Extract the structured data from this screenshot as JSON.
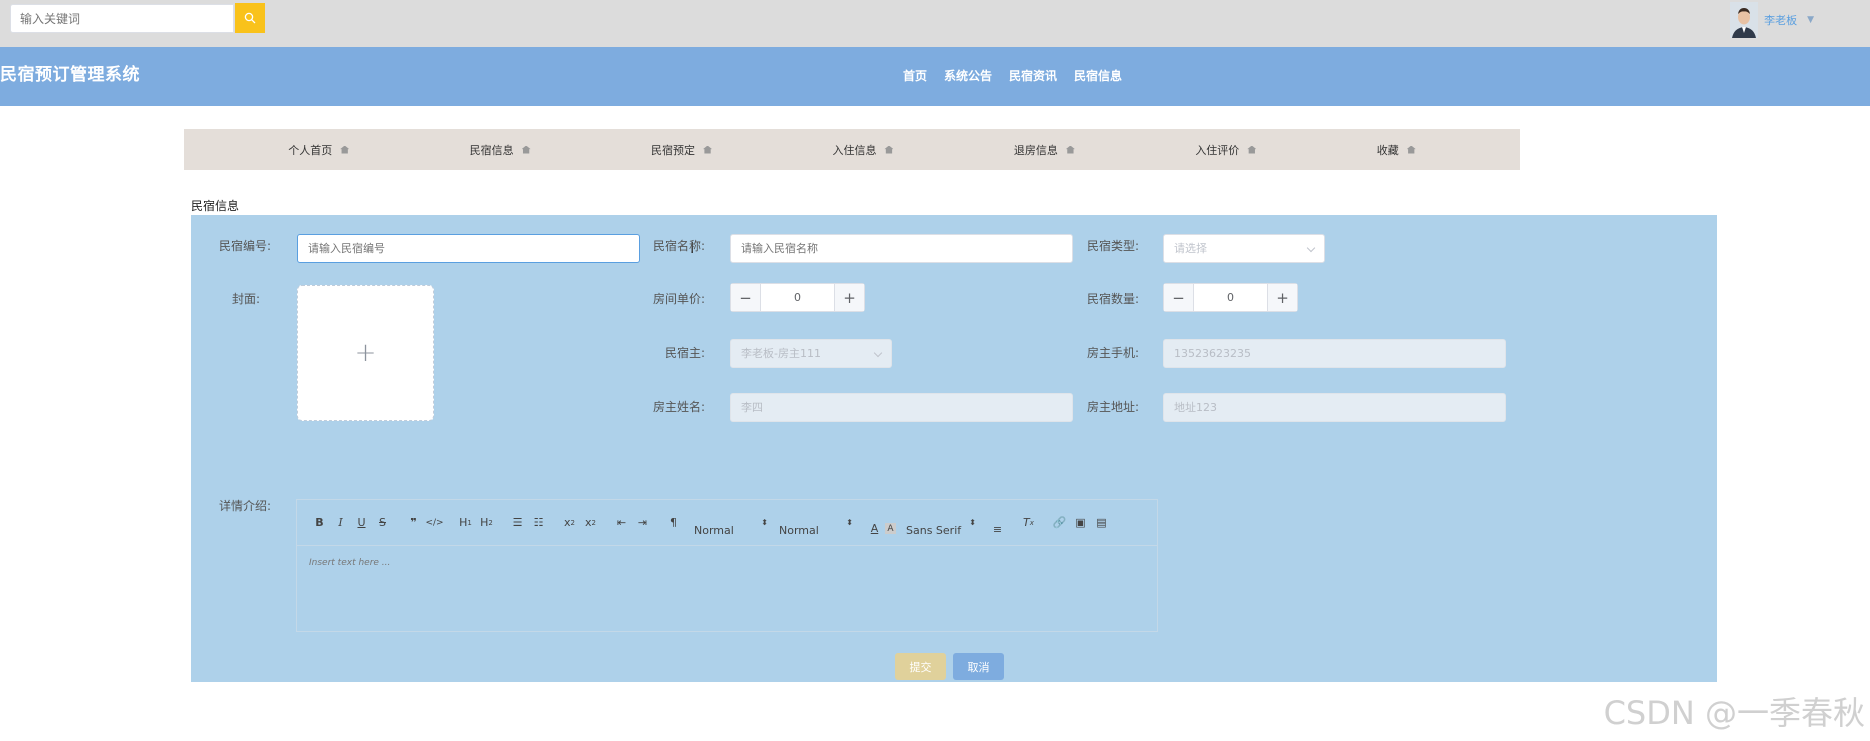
{
  "topbar": {
    "search_placeholder": "输入关键词",
    "user_name": "李老板"
  },
  "header": {
    "site_title": "民宿预订管理系统",
    "nav": [
      "首页",
      "系统公告",
      "民宿资讯",
      "民宿信息"
    ]
  },
  "subnav": [
    "个人首页",
    "民宿信息",
    "民宿预定",
    "入住信息",
    "退房信息",
    "入住评价",
    "收藏"
  ],
  "page": {
    "section_title": "民宿信息"
  },
  "form": {
    "labels": {
      "code": "民宿编号:",
      "name": "民宿名称:",
      "type": "民宿类型:",
      "cover": "封面:",
      "price": "房间单价:",
      "quantity": "民宿数量:",
      "owner": "民宿主:",
      "owner_phone": "房主手机:",
      "owner_name": "房主姓名:",
      "owner_address": "房主地址:",
      "detail": "详情介绍:"
    },
    "placeholders": {
      "code": "请输入民宿编号",
      "name": "请输入民宿名称",
      "type": "请选择"
    },
    "values": {
      "price": "0",
      "quantity": "0",
      "owner": "李老板-房主111",
      "owner_phone": "13523623235",
      "owner_name": "李四",
      "owner_address": "地址123"
    },
    "uploader_symbol": "+",
    "editor": {
      "header_select": "Normal",
      "size_select": "Normal",
      "font_select": "Sans Serif",
      "placeholder": "Insert text here ..."
    },
    "buttons": {
      "submit": "提交",
      "cancel": "取消"
    }
  },
  "watermark": "CSDN @一季春秋",
  "colors": {
    "header": "#7eacdf",
    "panel": "#aed1ea",
    "subnav": "#e4ded9",
    "search_button": "#f9c21b",
    "submit": "#e0d19b",
    "cancel": "#7eacdf"
  }
}
